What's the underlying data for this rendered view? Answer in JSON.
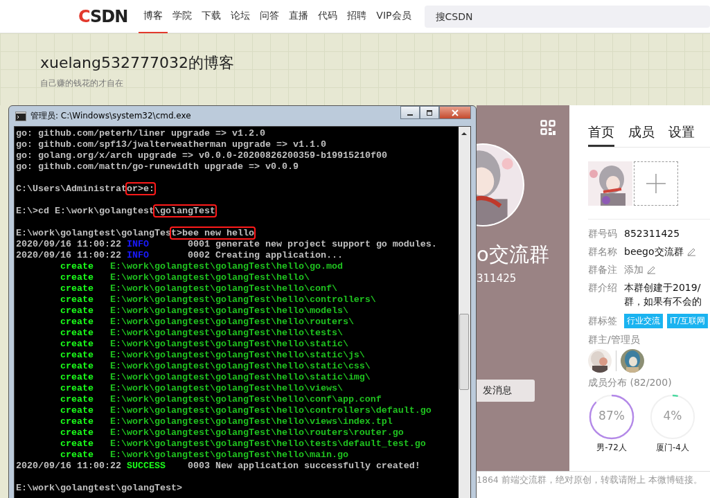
{
  "site_header": {
    "logo": "CSDN",
    "nav": [
      {
        "label": "博客",
        "selected": true
      },
      {
        "label": "学院",
        "selected": false
      },
      {
        "label": "下载",
        "selected": false
      },
      {
        "label": "论坛",
        "selected": false
      },
      {
        "label": "问答",
        "selected": false
      },
      {
        "label": "直播",
        "selected": false
      },
      {
        "label": "代码",
        "selected": false
      },
      {
        "label": "招聘",
        "selected": false
      },
      {
        "label": "VIP会员",
        "selected": false
      }
    ],
    "search": {
      "placeholder": "搜CSDN"
    }
  },
  "blog_banner": {
    "title": "xuelang532777032的博客",
    "subtitle": "自己赚的钱花的才自在"
  },
  "cmd_window": {
    "title": "管理员: C:\\Windows\\system32\\cmd.exe",
    "lines": [
      {
        "kind": "plain",
        "text": "go: github.com/peterh/liner upgrade => v1.2.0"
      },
      {
        "kind": "plain",
        "text": "go: github.com/spf13/jwalterweatherman upgrade => v1.1.0"
      },
      {
        "kind": "plain",
        "text": "go: golang.org/x/arch upgrade => v0.0.0-20200826200359-b19915210f00"
      },
      {
        "kind": "plain",
        "text": "go: github.com/mattn/go-runewidth upgrade => v0.0.9"
      },
      {
        "kind": "blank"
      },
      {
        "kind": "prompt",
        "text": "C:\\Users\\Administrat",
        "marked": "or>e:"
      },
      {
        "kind": "blank"
      },
      {
        "kind": "prompt",
        "text": "E:\\>cd E:\\work\\golangtest",
        "marked": "\\golangTest"
      },
      {
        "kind": "blank"
      },
      {
        "kind": "prompt",
        "text": "E:\\work\\golangtest\\golangTes",
        "marked": "t>bee new hello"
      },
      {
        "kind": "log",
        "time": "2020/09/16 11:00:22",
        "level": "INFO",
        "color": "#1a1aff",
        "code": "0001",
        "message": "generate new project support go modules."
      },
      {
        "kind": "log",
        "time": "2020/09/16 11:00:22",
        "level": "INFO",
        "color": "#1a1aff",
        "code": "0002",
        "message": "Creating application..."
      },
      {
        "kind": "create",
        "action": "create",
        "path": "E:\\work\\golangtest\\golangTest\\hello\\go.mod"
      },
      {
        "kind": "create",
        "action": "create",
        "path": "E:\\work\\golangtest\\golangTest\\hello\\"
      },
      {
        "kind": "create",
        "action": "create",
        "path": "E:\\work\\golangtest\\golangTest\\hello\\conf\\"
      },
      {
        "kind": "create",
        "action": "create",
        "path": "E:\\work\\golangtest\\golangTest\\hello\\controllers\\"
      },
      {
        "kind": "create",
        "action": "create",
        "path": "E:\\work\\golangtest\\golangTest\\hello\\models\\"
      },
      {
        "kind": "create",
        "action": "create",
        "path": "E:\\work\\golangtest\\golangTest\\hello\\routers\\"
      },
      {
        "kind": "create",
        "action": "create",
        "path": "E:\\work\\golangtest\\golangTest\\hello\\tests\\"
      },
      {
        "kind": "create",
        "action": "create",
        "path": "E:\\work\\golangtest\\golangTest\\hello\\static\\"
      },
      {
        "kind": "create",
        "action": "create",
        "path": "E:\\work\\golangtest\\golangTest\\hello\\static\\js\\"
      },
      {
        "kind": "create",
        "action": "create",
        "path": "E:\\work\\golangtest\\golangTest\\hello\\static\\css\\"
      },
      {
        "kind": "create",
        "action": "create",
        "path": "E:\\work\\golangtest\\golangTest\\hello\\static\\img\\"
      },
      {
        "kind": "create",
        "action": "create",
        "path": "E:\\work\\golangtest\\golangTest\\hello\\views\\"
      },
      {
        "kind": "create",
        "action": "create",
        "path": "E:\\work\\golangtest\\golangTest\\hello\\conf\\app.conf"
      },
      {
        "kind": "create",
        "action": "create",
        "path": "E:\\work\\golangtest\\golangTest\\hello\\controllers\\default.go"
      },
      {
        "kind": "create",
        "action": "create",
        "path": "E:\\work\\golangtest\\golangTest\\hello\\views\\index.tpl"
      },
      {
        "kind": "create",
        "action": "create",
        "path": "E:\\work\\golangtest\\golangTest\\hello\\routers\\router.go"
      },
      {
        "kind": "create",
        "action": "create",
        "path": "E:\\work\\golangtest\\golangTest\\hello\\tests\\default_test.go"
      },
      {
        "kind": "create",
        "action": "create",
        "path": "E:\\work\\golangtest\\golangTest\\hello\\main.go"
      },
      {
        "kind": "log",
        "time": "2020/09/16 11:00:22",
        "level": "SUCCESS",
        "color": "#1aff1a",
        "code": "0003",
        "message": "New application successfully created!"
      },
      {
        "kind": "blank"
      },
      {
        "kind": "plain",
        "text": "E:\\work\\golangtest\\golangTest>"
      }
    ]
  },
  "group_panel": {
    "name": "o交流群",
    "number": "311425",
    "message_button": "发消息",
    "tabs": [
      {
        "label": "首页",
        "selected": true
      },
      {
        "label": "成员",
        "selected": false
      },
      {
        "label": "设置",
        "selected": false
      }
    ],
    "info": [
      {
        "label": "群号码",
        "value": "852311425",
        "kind": "text"
      },
      {
        "label": "群名称",
        "value": "beego交流群",
        "kind": "editable"
      },
      {
        "label": "群备注",
        "value": "添加",
        "kind": "link"
      },
      {
        "label": "群介绍",
        "value": "本群创建于2019/",
        "more": "群，如果有不会的",
        "kind": "multiline"
      }
    ],
    "tags_label": "群标签",
    "tags": [
      "行业交流",
      "IT/互联网"
    ],
    "admins_label": "群主/管理员",
    "distribution_label": "成员分布 (82/200)",
    "distribution": [
      {
        "reading": "87%",
        "color": "#b388e8",
        "caption": "男-72人"
      },
      {
        "reading": "4%",
        "color": "#4cd9a0",
        "caption": "厦门-4人"
      }
    ]
  },
  "footer_text": "1864 前端交流群，绝对原创，转载请附上 本微博链接。"
}
